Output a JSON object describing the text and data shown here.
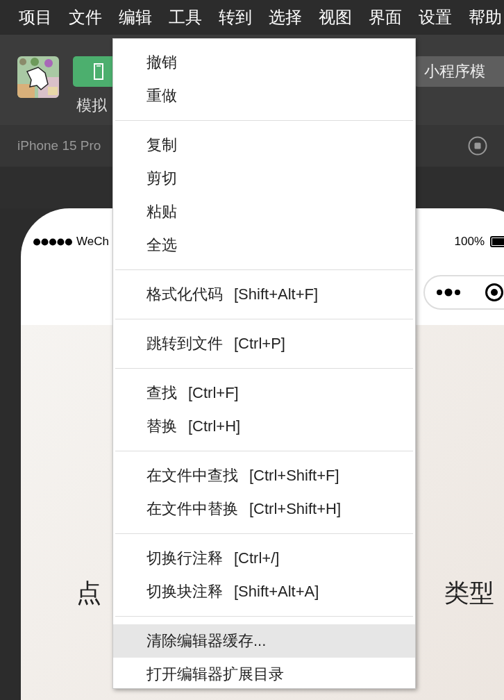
{
  "menubar": [
    {
      "label": "项目"
    },
    {
      "label": "文件"
    },
    {
      "label": "编辑"
    },
    {
      "label": "工具"
    },
    {
      "label": "转到"
    },
    {
      "label": "选择"
    },
    {
      "label": "视图"
    },
    {
      "label": "界面"
    },
    {
      "label": "设置"
    },
    {
      "label": "帮助"
    }
  ],
  "toolbar": {
    "simulator_label": "模拟",
    "mode_button": "小程序模"
  },
  "device_bar": {
    "device": "iPhone 15 Pro"
  },
  "phone": {
    "carrier": "WeCh",
    "battery": "100%",
    "content_left": "点",
    "content_right": "类型"
  },
  "menu": {
    "groups": [
      [
        {
          "label": "撤销",
          "highlighted": false
        },
        {
          "label": "重做",
          "highlighted": false
        }
      ],
      [
        {
          "label": "复制",
          "highlighted": false
        },
        {
          "label": "剪切",
          "highlighted": false
        },
        {
          "label": "粘贴",
          "highlighted": false
        },
        {
          "label": "全选",
          "highlighted": false
        }
      ],
      [
        {
          "label": "格式化代码",
          "shortcut": "[Shift+Alt+F]",
          "highlighted": false
        }
      ],
      [
        {
          "label": "跳转到文件",
          "shortcut": "[Ctrl+P]",
          "highlighted": false
        }
      ],
      [
        {
          "label": "查找",
          "shortcut": "[Ctrl+F]",
          "highlighted": false
        },
        {
          "label": "替换",
          "shortcut": "[Ctrl+H]",
          "highlighted": false
        }
      ],
      [
        {
          "label": "在文件中查找",
          "shortcut": "[Ctrl+Shift+F]",
          "highlighted": false
        },
        {
          "label": "在文件中替换",
          "shortcut": "[Ctrl+Shift+H]",
          "highlighted": false
        }
      ],
      [
        {
          "label": "切换行注释",
          "shortcut": "[Ctrl+/]",
          "highlighted": false
        },
        {
          "label": "切换块注释",
          "shortcut": "[Shift+Alt+A]",
          "highlighted": false
        }
      ],
      [
        {
          "label": "清除编辑器缓存...",
          "highlighted": true
        },
        {
          "label": "打开编辑器扩展目录",
          "highlighted": false
        }
      ]
    ]
  }
}
